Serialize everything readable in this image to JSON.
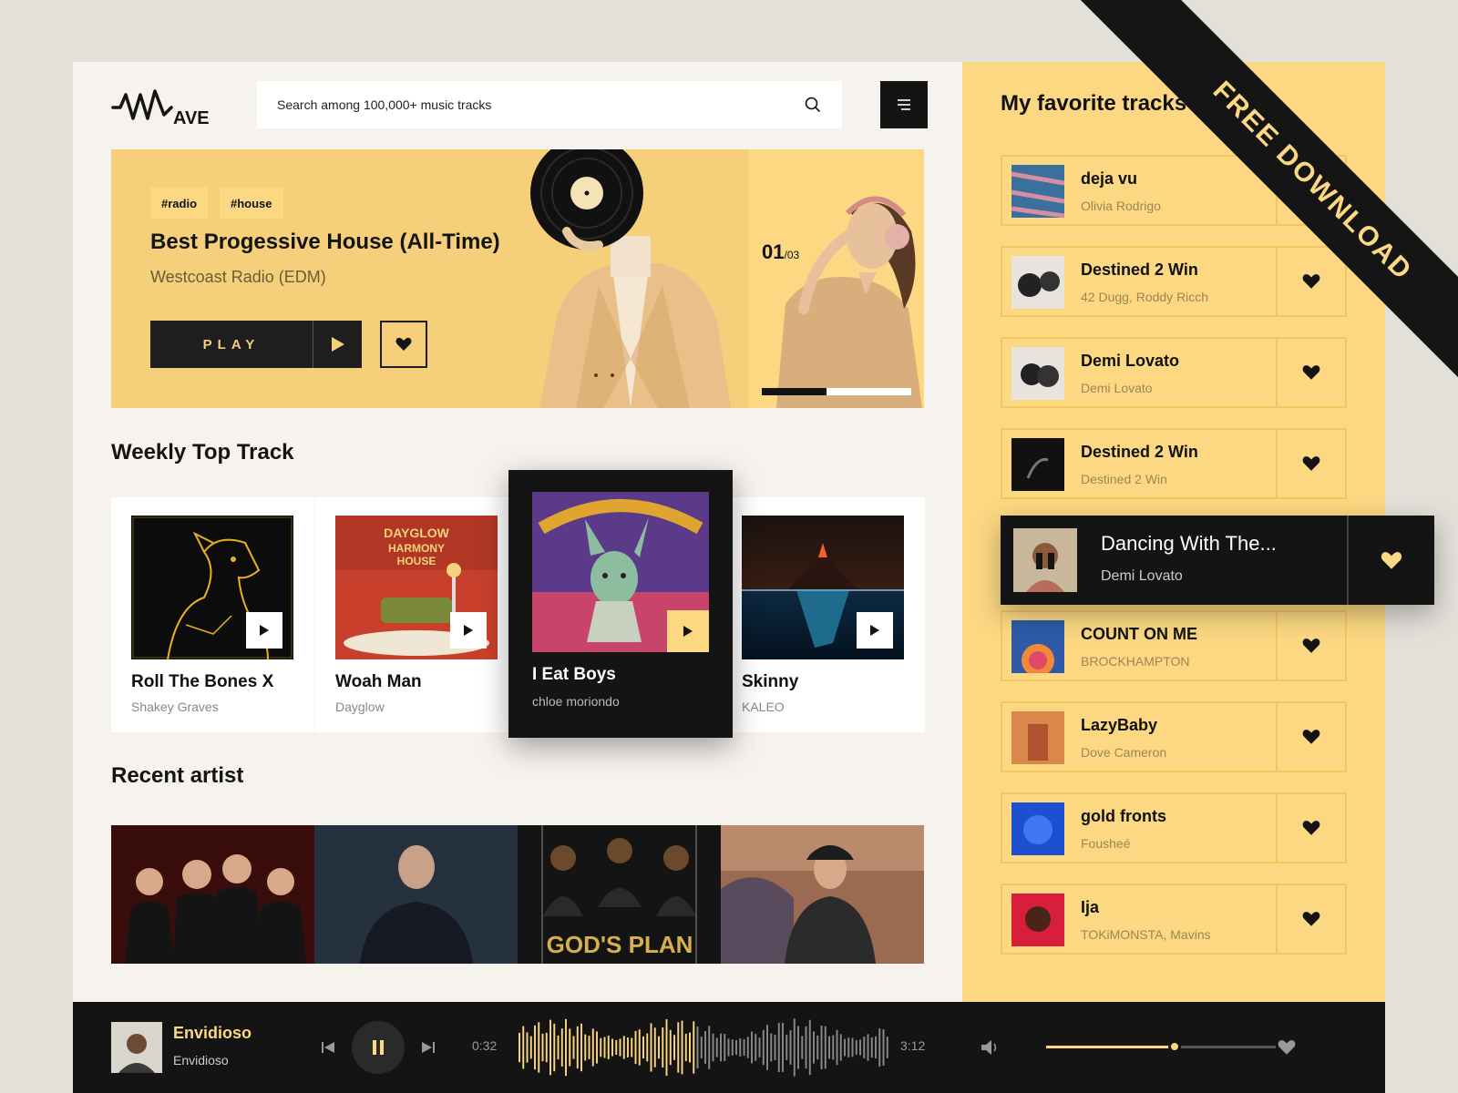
{
  "app": {
    "logo_text": "AVE"
  },
  "search": {
    "placeholder": "Search among 100,000+ music tracks"
  },
  "hero": {
    "tags": [
      "#radio",
      "#house"
    ],
    "title": "Best Progessive House (All-Time)",
    "subtitle": "Westcoast Radio (EDM)",
    "play_label": "PLAY",
    "counter_current": "01",
    "counter_total": "/03",
    "progress": 0.43
  },
  "weekly": {
    "title": "Weekly Top Track",
    "tracks": [
      {
        "title": "Roll The Bones X",
        "artist": "Shakey Graves"
      },
      {
        "title": "Woah Man",
        "artist": "Dayglow"
      },
      {
        "title": "I Eat Boys",
        "artist": "chloe moriondo"
      },
      {
        "title": "Skinny",
        "artist": "KALEO"
      }
    ]
  },
  "recent": {
    "title": "Recent artist"
  },
  "favorites": {
    "title": "My favorite tracks",
    "items": [
      {
        "title": "deja vu",
        "artist": "Olivia Rodrigo"
      },
      {
        "title": "Destined 2 Win",
        "artist": "42 Dugg, Roddy Ricch"
      },
      {
        "title": "Demi Lovato",
        "artist": "Demi Lovato"
      },
      {
        "title": "Destined 2 Win",
        "artist": "Destined 2 Win"
      },
      {
        "title": "Dancing With The...",
        "artist": "Demi Lovato"
      },
      {
        "title": "COUNT ON ME",
        "artist": "BROCKHAMPTON"
      },
      {
        "title": "LazyBaby",
        "artist": "Dove Cameron"
      },
      {
        "title": "gold fronts",
        "artist": "Fousheé"
      },
      {
        "title": "Ija",
        "artist": "TOKiMONSTA, Mavins"
      }
    ]
  },
  "banner": {
    "text": "FREE DOWNLOAD"
  },
  "player": {
    "title": "Envidioso",
    "artist": "Envidioso",
    "elapsed": "0:32",
    "duration": "3:12",
    "volume": 0.56
  },
  "colors": {
    "accent": "#fcd883",
    "dark": "#141414",
    "hero": "#f5cf79"
  }
}
